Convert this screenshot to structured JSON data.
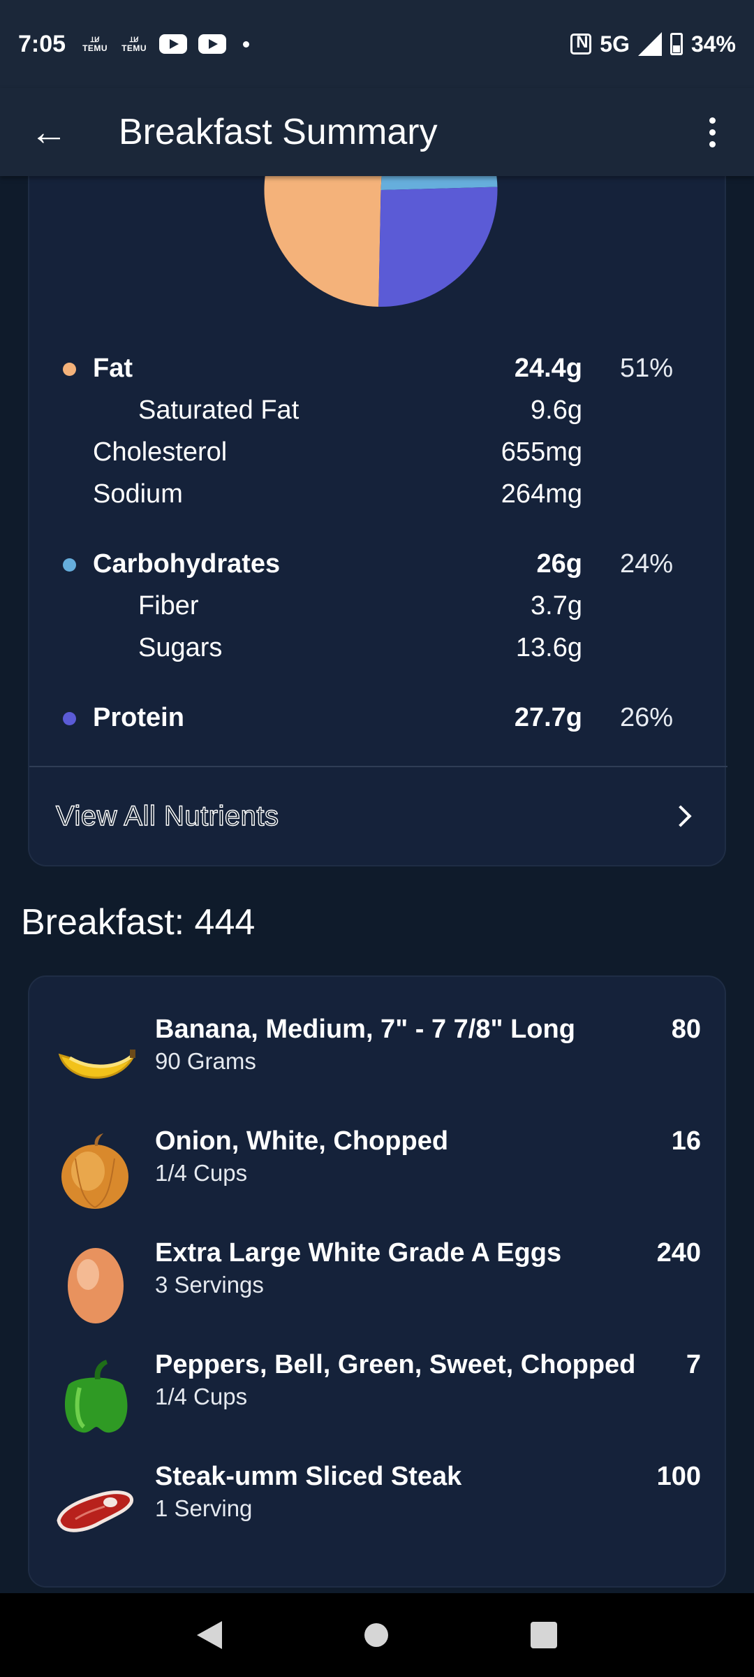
{
  "status_bar": {
    "time": "7:05",
    "temu_label": "TEMU",
    "network": "5G",
    "battery": "34%"
  },
  "app_bar": {
    "title": "Breakfast Summary"
  },
  "macros": {
    "chart_colors": {
      "fat": "#f4b27a",
      "carbohydrates": "#66aedc",
      "protein": "#5b5bd6"
    },
    "rows": [
      {
        "label": "Fat",
        "amount": "24.4g",
        "pct": "51%"
      },
      {
        "label": "Saturated Fat",
        "amount": "9.6g"
      },
      {
        "label": "Cholesterol",
        "amount": "655mg"
      },
      {
        "label": "Sodium",
        "amount": "264mg"
      },
      {
        "label": "Carbohydrates",
        "amount": "26g",
        "pct": "24%"
      },
      {
        "label": "Fiber",
        "amount": "3.7g"
      },
      {
        "label": "Sugars",
        "amount": "13.6g"
      },
      {
        "label": "Protein",
        "amount": "27.7g",
        "pct": "26%"
      }
    ],
    "view_all_label": "View All Nutrients"
  },
  "meal": {
    "heading": "Breakfast: 444",
    "foods": [
      {
        "name": "Banana, Medium, 7\" - 7 7/8\" Long",
        "quantity": "90 Grams",
        "calories": "80",
        "icon": "banana-icon"
      },
      {
        "name": "Onion, White, Chopped",
        "quantity": "1/4 Cups",
        "calories": "16",
        "icon": "onion-icon"
      },
      {
        "name": "Extra Large White Grade A Eggs",
        "quantity": "3 Servings",
        "calories": "240",
        "icon": "egg-icon"
      },
      {
        "name": "Peppers, Bell, Green, Sweet, Chopped",
        "quantity": "1/4 Cups",
        "calories": "7",
        "icon": "bell-pepper-icon"
      },
      {
        "name": "Steak-umm Sliced Steak",
        "quantity": "1 Serving",
        "calories": "100",
        "icon": "steak-icon"
      }
    ]
  }
}
